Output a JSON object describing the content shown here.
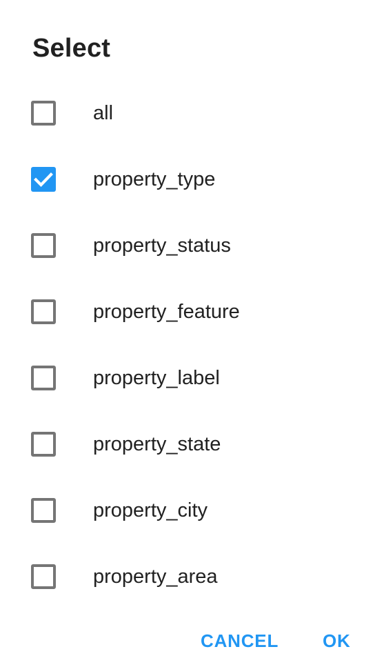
{
  "dialog": {
    "title": "Select",
    "options": [
      {
        "label": "all",
        "checked": false
      },
      {
        "label": "property_type",
        "checked": true
      },
      {
        "label": "property_status",
        "checked": false
      },
      {
        "label": "property_feature",
        "checked": false
      },
      {
        "label": "property_label",
        "checked": false
      },
      {
        "label": "property_state",
        "checked": false
      },
      {
        "label": "property_city",
        "checked": false
      },
      {
        "label": "property_area",
        "checked": false
      }
    ],
    "cancel_label": "CANCEL",
    "ok_label": "OK"
  },
  "colors": {
    "accent": "#2196f3",
    "checkbox_border": "#757575",
    "text": "#212121"
  }
}
